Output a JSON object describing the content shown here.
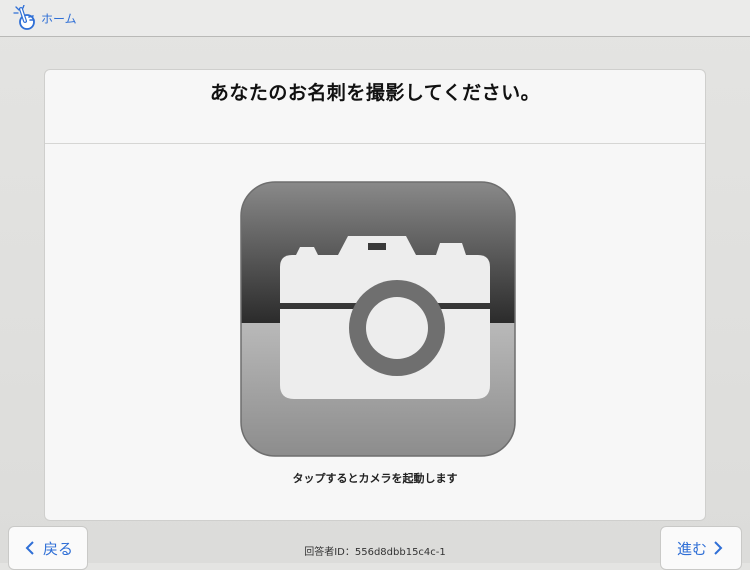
{
  "header": {
    "home_label": "ホーム",
    "home_icon": "hand-pointing-icon"
  },
  "main": {
    "title": "あなたのお名刺を撮影してください。",
    "camera_icon": "camera-icon",
    "camera_caption": "タップするとカメラを起動します"
  },
  "footer": {
    "back_label": "戻る",
    "next_label": "進む",
    "respondent_id": "回答者ID：556d8dbb15c4c-1"
  },
  "colors": {
    "accent": "#2f6fd6",
    "card_background": "#f7f7f7",
    "page_background": "#e0e0de"
  }
}
